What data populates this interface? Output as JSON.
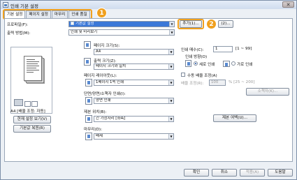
{
  "window": {
    "title": "인쇄 기본 설정",
    "close_glyph": "✕"
  },
  "tabs": [
    {
      "label": "기본 설정"
    },
    {
      "label": "페이지 설정"
    },
    {
      "label": "마무리"
    },
    {
      "label": "인쇄 품질"
    }
  ],
  "callouts": [
    "1",
    "2"
  ],
  "profile": {
    "label": "프로파일(F):",
    "value": "기본값 설정",
    "add_button": "추가(1)...",
    "edit_button": "(2)..."
  },
  "output_method": {
    "label": "출력 방법(M):",
    "value": "인쇄 및 미리보기"
  },
  "page_size": {
    "label": "페이지 크기(S):",
    "value": "A4"
  },
  "output_size": {
    "label": "출력 크기(Z):",
    "value": "페이지 크기와 일치"
  },
  "page_layout": {
    "label": "페이지 레이아웃(L):",
    "value": "1페이지 1쪽 인쇄"
  },
  "duplex": {
    "label": "단면/양면/소책자 인쇄(I):",
    "value": "양면 인쇄"
  },
  "binding": {
    "label": "제본 위치(B):",
    "value": "긴 가장자리 [좌측]"
  },
  "finishing": {
    "label": "마무리(D):",
    "value": "배제"
  },
  "copies": {
    "label": "인쇄 매수(C):",
    "value": "1",
    "range": "[1 ~ 99]"
  },
  "orientation": {
    "label": "인쇄 방향(O)",
    "options": [
      {
        "label": "세로 인쇄",
        "selected": true
      },
      {
        "label": "가로 인쇄",
        "selected": false
      }
    ]
  },
  "manual_scaling": {
    "label": "수동 배율 조정(A)",
    "checked": false,
    "scale_label": "배율 조정(R):",
    "scale_value": "100",
    "scale_range": "% [25 ~ 200]"
  },
  "booklet_button": "소책자(K)...",
  "margin_button": "제본 여백(U)...",
  "preview": {
    "caption": "A4 [배율 조정: 자동]",
    "settings_button": "현재 설정 보기(V)",
    "restore_button": "기본값 복원(R)"
  },
  "footer": {
    "ok": "확인",
    "cancel": "취소",
    "apply": "적용(A)",
    "help": "도움말"
  }
}
